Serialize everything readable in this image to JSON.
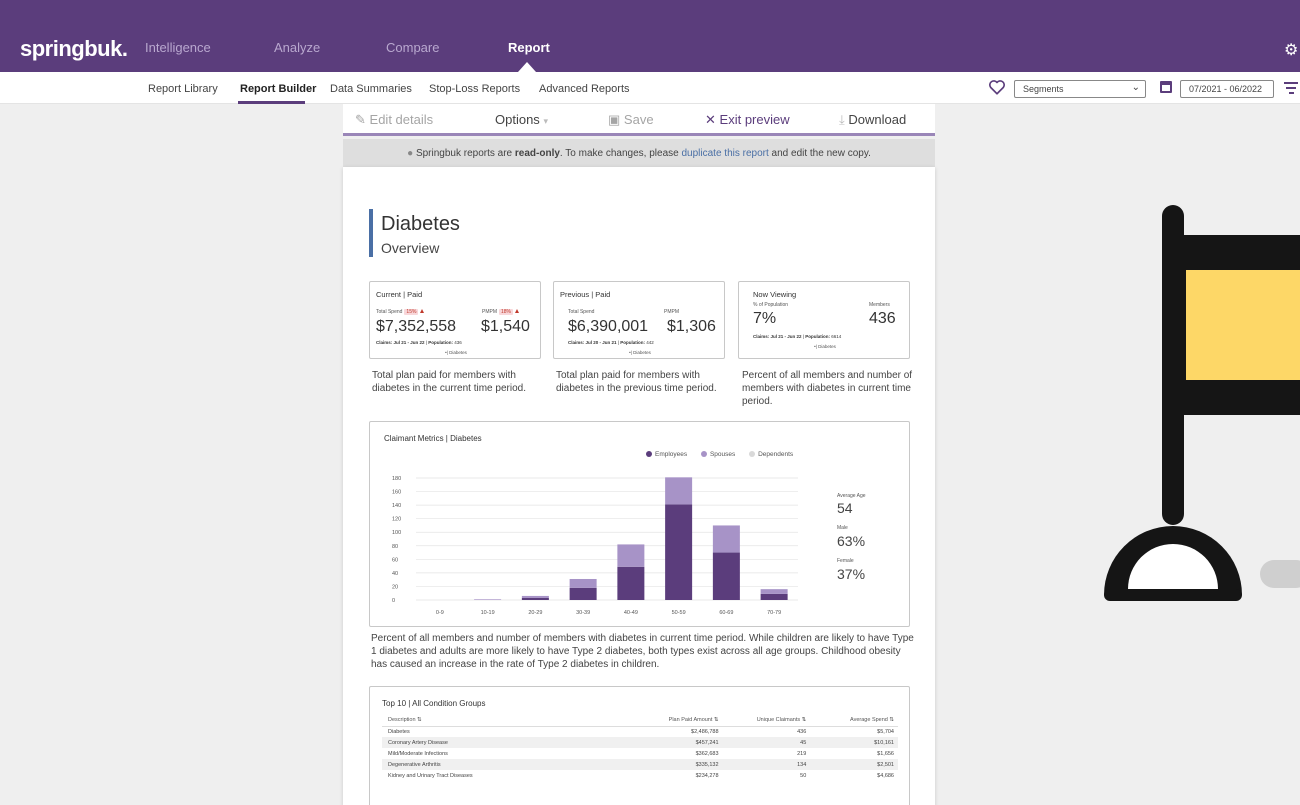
{
  "app": {
    "logo": "springbuk."
  },
  "topnav": {
    "items": [
      "Intelligence",
      "Analyze",
      "Compare",
      "Report"
    ],
    "active": "Report"
  },
  "subnav": {
    "items": [
      "Report Library",
      "Report Builder",
      "Data Summaries",
      "Stop-Loss Reports",
      "Advanced Reports"
    ],
    "active": "Report Builder"
  },
  "controls": {
    "segments": "Segments",
    "date_range": "07/2021 - 06/2022"
  },
  "toolbar": {
    "edit": "Edit details",
    "options": "Options",
    "save": "Save",
    "exit": "Exit preview",
    "download": "Download"
  },
  "notice": {
    "prefix": "Springbuk reports are ",
    "bold": "read-only",
    "middle": ". To make changes, please ",
    "link": "duplicate this report",
    "suffix": " and edit the new copy."
  },
  "report": {
    "title": "Diabetes",
    "subtitle": "Overview",
    "cards": [
      {
        "header": "Current | Paid",
        "label1": "Total Spend",
        "badge1": "15%",
        "value1": "$7,352,558",
        "label2": "PMPM",
        "badge2": "18%",
        "value2": "$1,540",
        "claims": "Claims: Jul 21 - Jun 22",
        "population_label": "Population:",
        "population": "436",
        "tag": "Diabetes",
        "description": "Total plan paid for members with diabetes in the current time period."
      },
      {
        "header": "Previous | Paid",
        "label1": "Total Spend",
        "value1": "$6,390,001",
        "label2": "PMPM",
        "value2": "$1,306",
        "claims": "Claims: Jul 20 - Jun 21",
        "population_label": "Population:",
        "population": "442",
        "tag": "Diabetes",
        "description": "Total plan paid for members with diabetes in the previous time period."
      },
      {
        "header": "Now Viewing",
        "label1": "% of Population",
        "value1": "7%",
        "label2": "Members",
        "value2": "436",
        "claims": "Claims: Jul 21 - Jun 22",
        "population_label": "Population:",
        "population": "6614",
        "tag": "Diabetes",
        "description": "Percent of all members and number of members with diabetes in current time period."
      }
    ],
    "claimant": {
      "title": "Claimant Metrics | Diabetes",
      "stats": [
        {
          "label": "Average Age",
          "value": "54"
        },
        {
          "label": "Male",
          "value": "63%"
        },
        {
          "label": "Female",
          "value": "37%"
        }
      ]
    },
    "chart_paragraph": "Percent of all members and number of members with diabetes in current time period. While children are likely to have Type 1 diabetes and adults are more likely to have Type 2 diabetes, both types exist across all age groups. Childhood obesity has caused an increase in the rate of Type 2 diabetes in children.",
    "top10": {
      "title": "Top 10 | All Condition Groups",
      "headers": [
        "Description",
        "Plan Paid Amount",
        "Unique Claimants",
        "Average Spend"
      ],
      "rows": [
        [
          "Diabetes",
          "$2,486,788",
          "436",
          "$5,704"
        ],
        [
          "Coronary Artery Disease",
          "$457,241",
          "45",
          "$10,161"
        ],
        [
          "Mild/Moderate Infections",
          "$362,683",
          "219",
          "$1,656"
        ],
        [
          "Degenerative Arthritis",
          "$335,132",
          "134",
          "$2,501"
        ],
        [
          "Kidney and Urinary Tract Diseases",
          "$234,278",
          "50",
          "$4,686"
        ]
      ]
    }
  },
  "chart_data": {
    "type": "bar",
    "stacked": true,
    "categories": [
      "0-9",
      "10-19",
      "20-29",
      "30-39",
      "40-49",
      "50-59",
      "60-69",
      "70-79"
    ],
    "series": [
      {
        "name": "Employees",
        "values": [
          0,
          0,
          3,
          18,
          49,
          141,
          70,
          9
        ],
        "color": "#5b3d7c"
      },
      {
        "name": "Spouses",
        "values": [
          0,
          1,
          3,
          13,
          33,
          40,
          40,
          7
        ],
        "color": "#a793c7"
      },
      {
        "name": "Dependents",
        "values": [
          0,
          0,
          0,
          0,
          0,
          0,
          0,
          0
        ],
        "color": "#d9d9d9"
      }
    ],
    "yticks": [
      0,
      20,
      40,
      60,
      80,
      100,
      120,
      140,
      160,
      180
    ],
    "ylim": [
      0,
      180
    ],
    "grid": true,
    "legend": "top-right"
  }
}
